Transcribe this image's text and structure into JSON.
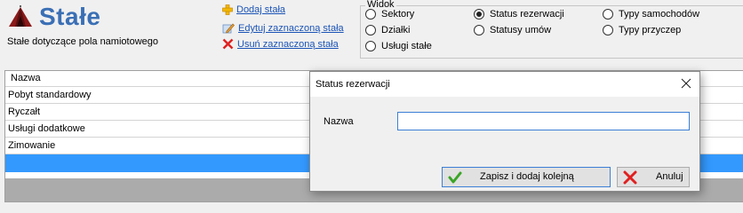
{
  "header": {
    "title": "Stałe",
    "subtitle": "Stałe dotyczące pola namiotowego",
    "title_color": "#3a6fb5",
    "logo_icon": "tent-icon"
  },
  "actions": {
    "add": "Dodaj stała",
    "edit": "Edytuj zaznaczoną stała",
    "delete": "Usuń zaznaczoną stała",
    "link_color": "#1b54b6"
  },
  "view_group": {
    "legend": "Widok",
    "options": [
      {
        "label": "Sektory",
        "checked": false
      },
      {
        "label": "Działki",
        "checked": false
      },
      {
        "label": "Usługi stałe",
        "checked": false
      },
      {
        "label": "Status rezerwacji",
        "checked": true
      },
      {
        "label": "Statusy umów",
        "checked": false
      },
      {
        "label": "Typy samochodów",
        "checked": false
      },
      {
        "label": "Typy przyczep",
        "checked": false
      }
    ]
  },
  "table": {
    "column": "Nazwa",
    "rows": [
      "Pobyt standardowy",
      "Ryczałt",
      "Usługi dodatkowe",
      "Zimowanie",
      ""
    ],
    "selected_row": 4,
    "selection_color": "#3399ff"
  },
  "dialog": {
    "title": "Status rezerwacji",
    "label": "Nazwa",
    "input_value": "",
    "save_button": "Zapisz i dodaj kolejną",
    "cancel_button": "Anuluj"
  }
}
